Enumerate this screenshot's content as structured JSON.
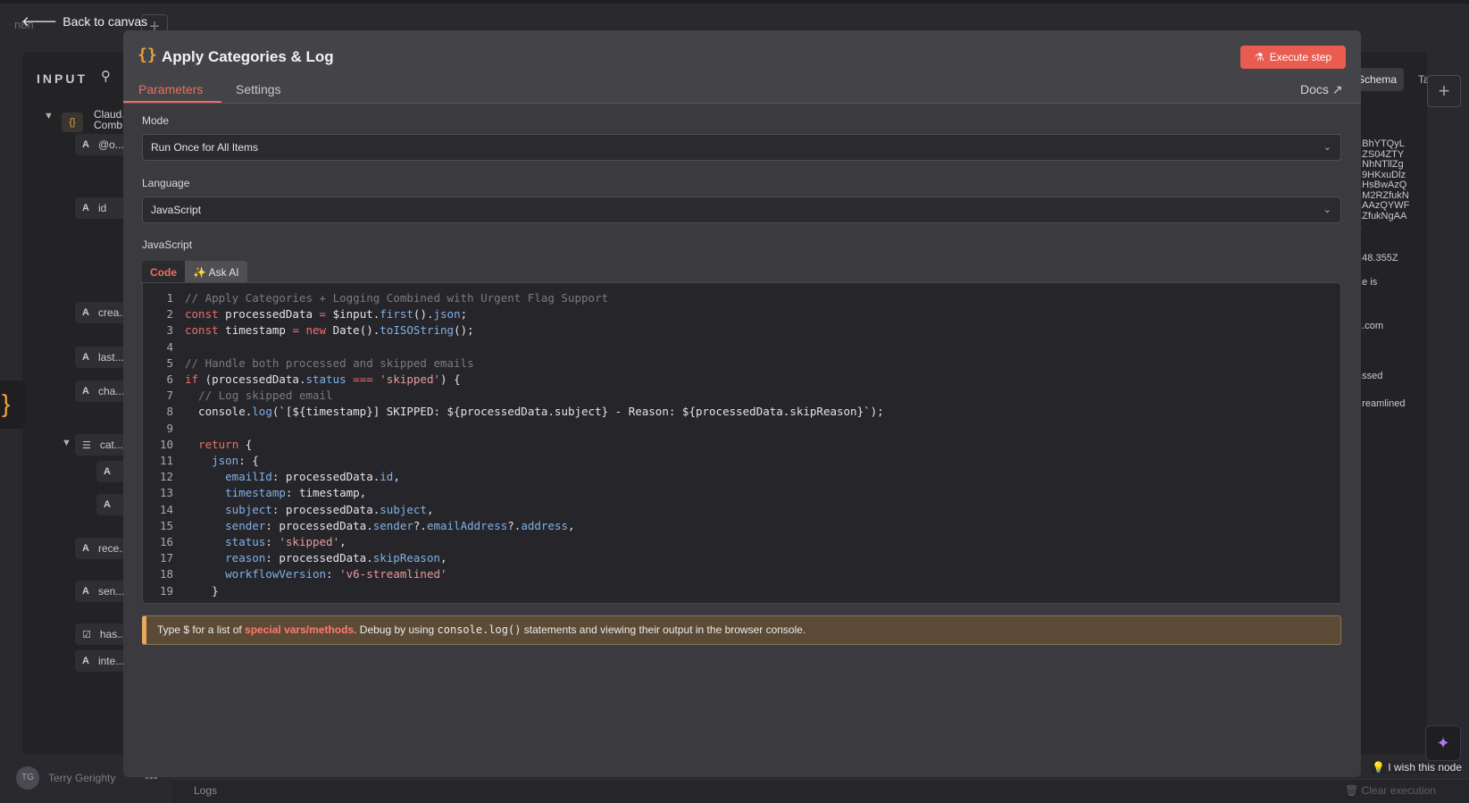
{
  "background": {
    "back_label": "Back to canvas",
    "logo_text": "n8n",
    "input_title": "INPUT",
    "tree_node_label": "Claud... Comb...",
    "fields": [
      {
        "type": "A",
        "label": "@o..."
      },
      {
        "type": "A",
        "label": "id"
      },
      {
        "type": "A",
        "label": "crea..."
      },
      {
        "type": "A",
        "label": "last..."
      },
      {
        "type": "A",
        "label": "cha..."
      },
      {
        "type": "list",
        "label": "cat..."
      },
      {
        "type": "A",
        "label": ""
      },
      {
        "type": "A",
        "label": ""
      },
      {
        "type": "A",
        "label": "rece..."
      },
      {
        "type": "A",
        "label": "sen..."
      },
      {
        "type": "check",
        "label": "has..."
      },
      {
        "type": "A",
        "label": "inte..."
      }
    ],
    "user_initials": "TG",
    "user_name": "Terry Gerighty",
    "logs_label": "Logs",
    "clear_execution": "Clear execution",
    "schema_tab": "Schema",
    "table_tab": "Ta",
    "output_lines": [
      "...BhYTQyL",
      "...ZS04ZTY",
      "...NhNTllZg",
      "...9HKxuDlz",
      "...HsBwAzQ",
      "...M2RZfukN",
      "...AAzQYWF",
      "...ZfukNgAA",
      "...",
      "...48.355Z",
      "...e is",
      "....com",
      "...ssed",
      "...reamlined"
    ],
    "wish_text": "I wish this node"
  },
  "modal": {
    "node_title": "Apply Categories & Log",
    "execute_label": "Execute step",
    "tabs": [
      "Parameters",
      "Settings"
    ],
    "docs_label": "Docs",
    "mode_label": "Mode",
    "mode_value": "Run Once for All Items",
    "language_label": "Language",
    "language_value": "JavaScript",
    "code_section_label": "JavaScript",
    "code_tab": "Code",
    "ask_ai_tab": "✨ Ask AI",
    "hint": {
      "prefix": "Type $ for a list of ",
      "link": "special vars/methods",
      "middle": ". Debug by using ",
      "code": "console.log()",
      "suffix": " statements and viewing their output in the browser console."
    }
  },
  "code_lines": [
    "// Apply Categories + Logging Combined with Urgent Flag Support",
    "const processedData = $input.first().json;",
    "const timestamp = new Date().toISOString();",
    "",
    "// Handle both processed and skipped emails",
    "if (processedData.status === 'skipped') {",
    "  // Log skipped email",
    "  console.log(`[${timestamp}] SKIPPED: ${processedData.subject} - Reason: ${processedData.skipReason}`);",
    "",
    "  return {",
    "    json: {",
    "      emailId: processedData.id,",
    "      timestamp: timestamp,",
    "      subject: processedData.subject,",
    "      sender: processedData.sender?.emailAddress?.address,",
    "      status: 'skipped',",
    "      reason: processedData.skipReason,",
    "      workflowVersion: 'v6-streamlined'",
    "    }"
  ],
  "colors": {
    "accent": "#ea6f61",
    "execute_button": "#ea5b50",
    "node_icon": "#e99f3a",
    "code_comment": "#7a7a80",
    "code_keyword": "#ee6d6d",
    "code_property": "#7fb0e8",
    "code_string": "#e69a9a",
    "hint_bg": "#5b4a36"
  }
}
